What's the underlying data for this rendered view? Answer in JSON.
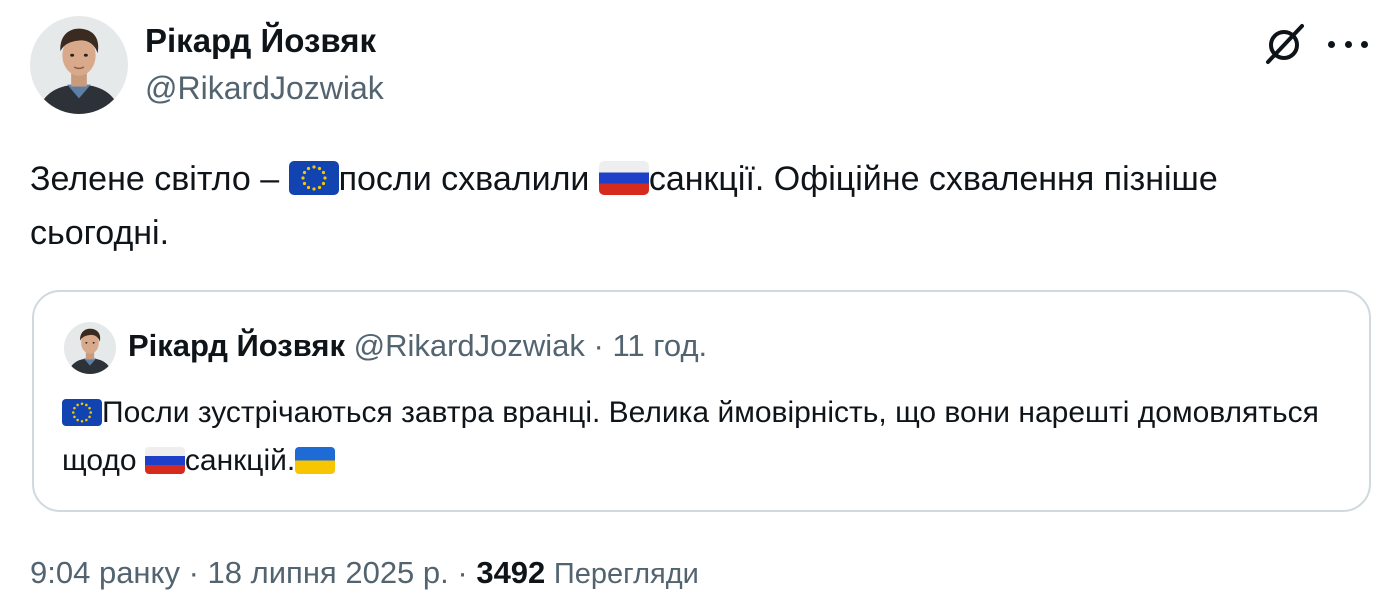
{
  "author": {
    "name": "Рікард Йозвяк",
    "handle": "@RikardJozwiak"
  },
  "toolbar": {
    "grok_icon": "grok-icon",
    "more_icon": "more-icon"
  },
  "tweet": {
    "text_part1": "Зелене світло – ",
    "flag1": "eu-flag",
    "text_part2": "посли схвалили ",
    "flag2": "russia-flag",
    "text_part3": "санкції. Офіційне схвалення пізніше сьогодні."
  },
  "quote": {
    "name": "Рікард Йозвяк",
    "handle": "@RikardJozwiak",
    "separator": " · ",
    "time": "11 год.",
    "flag1": "eu-flag",
    "text_part1": "Посли зустрічаються завтра вранці. Велика ймовірність, що вони нарешті домовляться щодо ",
    "flag2": "russia-flag",
    "text_part2": "санкцій.",
    "flag3": "ukraine-flag"
  },
  "footer": {
    "time": "9:04 ранку",
    "separator1": " · ",
    "date": "18 липня 2025 р.",
    "separator2": " · ",
    "views_count": "3492",
    "views_label": "Перегляди"
  },
  "colors": {
    "text_primary": "#0f1419",
    "text_secondary": "#536471",
    "border": "#cfd9de",
    "eu_blue": "#1144b0",
    "eu_star": "#f7c600"
  }
}
